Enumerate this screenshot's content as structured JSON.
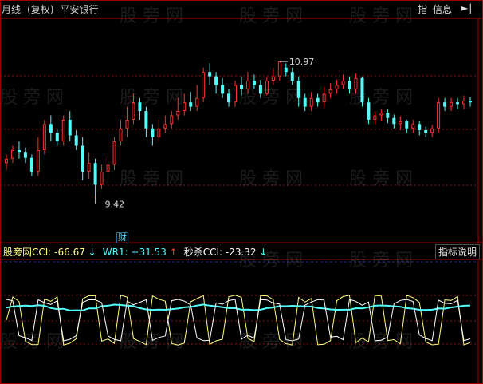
{
  "header": {
    "period": "月线",
    "adjust": "(复权)",
    "stock_name": "平安银行",
    "btn_index": "指",
    "btn_info": "信息",
    "nav_icon": "arrow-right-bar-icon"
  },
  "watermark": "股 旁 网",
  "price_panel": {
    "high_label": "10.97",
    "low_label": "9.42",
    "badge": "财",
    "ylim": [
      8.9,
      11.45
    ],
    "up_color": "#ff3030",
    "down_color": "#54fcfc"
  },
  "indicator": {
    "items": [
      {
        "label": "股旁网CCI:",
        "value": "-66.67",
        "arrow": "↓",
        "color": "#ffff80",
        "arrow_color": "#54fcfc"
      },
      {
        "label": "WR1:",
        "value": "+31.53",
        "arrow": "↑",
        "color": "#54fcfc",
        "arrow_color": "#ff3030"
      },
      {
        "label": "秒杀CCI:",
        "value": "-23.32",
        "arrow": "↓",
        "color": "#ffffff",
        "arrow_color": "#54fcfc"
      }
    ],
    "help_button": "指标说明"
  },
  "chart_data": {
    "type": "candlestick",
    "candles": [
      [
        9.8,
        9.85,
        9.72,
        9.9
      ],
      [
        9.85,
        9.95,
        9.8,
        10.0
      ],
      [
        9.95,
        9.92,
        9.85,
        10.05
      ],
      [
        9.92,
        9.86,
        9.8,
        9.98
      ],
      [
        9.86,
        9.7,
        9.65,
        9.9
      ],
      [
        9.7,
        9.95,
        9.65,
        10.1
      ],
      [
        9.95,
        10.25,
        9.9,
        10.3
      ],
      [
        10.25,
        10.15,
        10.05,
        10.35
      ],
      [
        10.15,
        10.05,
        10.0,
        10.2
      ],
      [
        10.05,
        10.3,
        10.0,
        10.35
      ],
      [
        10.3,
        10.12,
        10.05,
        10.4
      ],
      [
        10.12,
        10.0,
        9.95,
        10.18
      ],
      [
        10.0,
        9.7,
        9.6,
        10.1
      ],
      [
        9.7,
        9.8,
        9.62,
        9.92
      ],
      [
        9.8,
        9.55,
        9.42,
        9.85
      ],
      [
        9.55,
        9.7,
        9.5,
        9.78
      ],
      [
        9.7,
        9.78,
        9.6,
        9.88
      ],
      [
        9.78,
        10.05,
        9.72,
        10.1
      ],
      [
        10.05,
        10.2,
        10.0,
        10.3
      ],
      [
        10.2,
        10.3,
        10.1,
        10.45
      ],
      [
        10.3,
        10.5,
        10.25,
        10.6
      ],
      [
        10.5,
        10.4,
        10.3,
        10.55
      ],
      [
        10.4,
        10.2,
        10.1,
        10.45
      ],
      [
        10.2,
        10.1,
        10.0,
        10.25
      ],
      [
        10.1,
        10.2,
        10.05,
        10.3
      ],
      [
        10.2,
        10.25,
        10.15,
        10.35
      ],
      [
        10.25,
        10.35,
        10.2,
        10.4
      ],
      [
        10.35,
        10.4,
        10.3,
        10.55
      ],
      [
        10.4,
        10.5,
        10.35,
        10.6
      ],
      [
        10.5,
        10.45,
        10.4,
        10.62
      ],
      [
        10.45,
        10.55,
        10.4,
        10.7
      ],
      [
        10.55,
        10.85,
        10.5,
        10.9
      ],
      [
        10.85,
        10.8,
        10.7,
        10.95
      ],
      [
        10.8,
        10.7,
        10.6,
        10.85
      ],
      [
        10.7,
        10.6,
        10.55,
        10.78
      ],
      [
        10.6,
        10.5,
        10.45,
        10.65
      ],
      [
        10.5,
        10.7,
        10.45,
        10.75
      ],
      [
        10.7,
        10.65,
        10.58,
        10.8
      ],
      [
        10.65,
        10.75,
        10.6,
        10.85
      ],
      [
        10.75,
        10.7,
        10.65,
        10.82
      ],
      [
        10.7,
        10.6,
        10.55,
        10.76
      ],
      [
        10.6,
        10.75,
        10.58,
        10.8
      ],
      [
        10.75,
        10.8,
        10.7,
        10.9
      ],
      [
        10.8,
        10.97,
        10.75,
        10.97
      ],
      [
        10.9,
        10.85,
        10.8,
        10.95
      ],
      [
        10.85,
        10.75,
        10.7,
        10.9
      ],
      [
        10.75,
        10.55,
        10.45,
        10.8
      ],
      [
        10.55,
        10.45,
        10.4,
        10.6
      ],
      [
        10.45,
        10.55,
        10.4,
        10.62
      ],
      [
        10.55,
        10.5,
        10.45,
        10.6
      ],
      [
        10.5,
        10.6,
        10.45,
        10.68
      ],
      [
        10.6,
        10.65,
        10.55,
        10.72
      ],
      [
        10.65,
        10.7,
        10.6,
        10.76
      ],
      [
        10.7,
        10.75,
        10.65,
        10.82
      ],
      [
        10.75,
        10.65,
        10.6,
        10.8
      ],
      [
        10.65,
        10.78,
        10.6,
        10.83
      ],
      [
        10.78,
        10.5,
        10.45,
        10.8
      ],
      [
        10.5,
        10.3,
        10.25,
        10.55
      ],
      [
        10.3,
        10.35,
        10.25,
        10.4
      ],
      [
        10.35,
        10.38,
        10.28,
        10.42
      ],
      [
        10.38,
        10.32,
        10.26,
        10.42
      ],
      [
        10.32,
        10.25,
        10.2,
        10.36
      ],
      [
        10.25,
        10.28,
        10.18,
        10.34
      ],
      [
        10.28,
        10.2,
        10.15,
        10.3
      ],
      [
        10.2,
        10.25,
        10.15,
        10.3
      ],
      [
        10.25,
        10.18,
        10.12,
        10.28
      ],
      [
        10.18,
        10.15,
        10.1,
        10.22
      ],
      [
        10.15,
        10.2,
        10.1,
        10.24
      ],
      [
        10.2,
        10.5,
        10.15,
        10.55
      ],
      [
        10.5,
        10.45,
        10.4,
        10.55
      ],
      [
        10.45,
        10.5,
        10.4,
        10.55
      ],
      [
        10.5,
        10.48,
        10.42,
        10.55
      ],
      [
        10.48,
        10.52,
        10.42,
        10.58
      ],
      [
        10.52,
        10.5,
        10.45,
        10.56
      ]
    ],
    "indicator_ylim": [
      -300,
      300
    ],
    "indicator_series": [
      {
        "name": "股旁网CCI",
        "color": "#ffff80",
        "amplitude": 240
      },
      {
        "name": "WR1",
        "color": "#54fcfc",
        "amplitude": 22
      },
      {
        "name": "秒杀CCI",
        "color": "#ffffff",
        "amplitude": 200
      }
    ]
  }
}
